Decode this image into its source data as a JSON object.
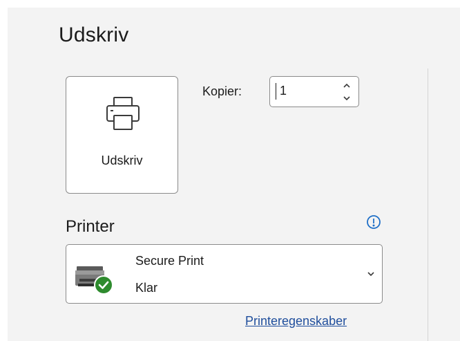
{
  "page": {
    "title": "Udskriv"
  },
  "print_button": {
    "label": "Udskriv",
    "icon": "printer-icon"
  },
  "copies": {
    "label": "Kopier:",
    "value": "1"
  },
  "printer_section": {
    "title": "Printer",
    "info_icon": "info-icon",
    "selected_printer": {
      "name": "Secure Print",
      "status": "Klar",
      "icon": "printer-ready-icon"
    },
    "properties_link": "Printeregenskaber"
  },
  "colors": {
    "background": "#f3f3f3",
    "card": "#ffffff",
    "border": "#8a8a8a",
    "link": "#1f4e9c",
    "info_accent": "#1f6fc7",
    "ready_badge": "#2e8b2e"
  }
}
